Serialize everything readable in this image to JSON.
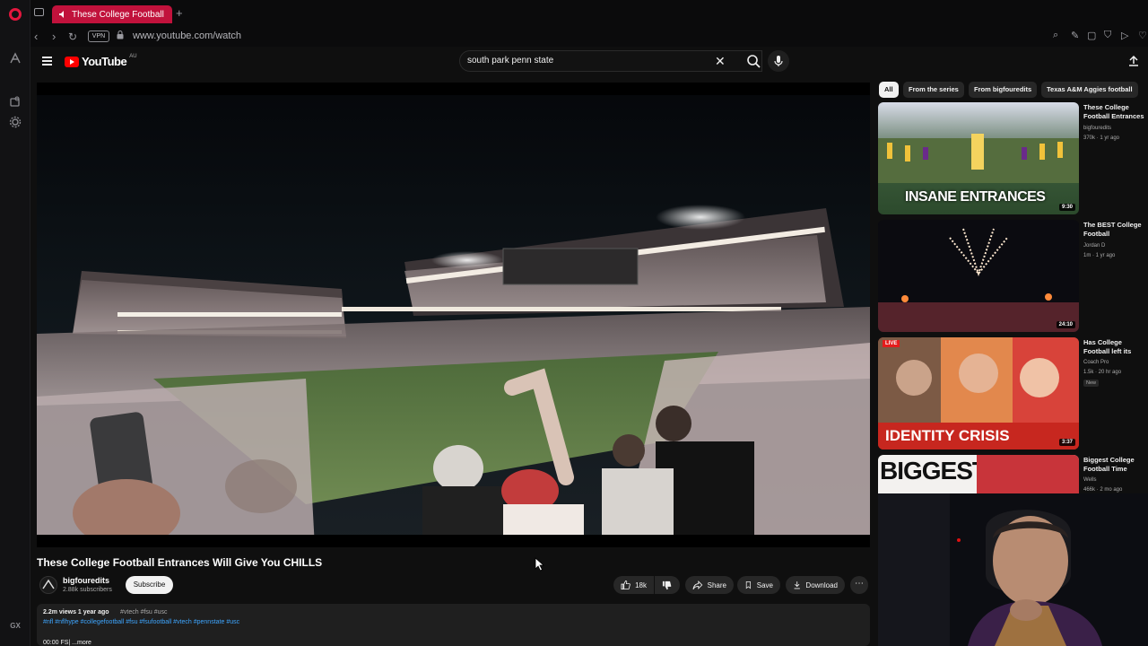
{
  "browser": {
    "tab_title": "These College Football",
    "url": "www.youtube.com/watch",
    "vpn_label": "VPN",
    "rail_bottom_label": "GX"
  },
  "youtube": {
    "region": "AU",
    "search_query": "south park penn state",
    "video": {
      "title": "These College Football Entrances Will Give You CHILLS",
      "channel": "bigfouredits",
      "subscribers": "2.88k subscribers",
      "subscribe_label": "Subscribe",
      "likes": "18k",
      "share_label": "Share",
      "save_label": "Save",
      "download_label": "Download",
      "views_age": "2.2m views  1 year ago",
      "top_tags": "#vtech #fsu #usc",
      "hashtags": "#nfl #nflhype #collegefootball #fsu #fsufootball #vtech #pennstate #usc",
      "desc_line": "00:00 FS|  ...more"
    },
    "chips": [
      "All",
      "From the series",
      "From bigfouredits",
      "Texas A&M Aggies football"
    ],
    "recommendations": [
      {
        "title": "These College Football Entrances Will Give You CHILLS",
        "channel": "bigfouredits",
        "meta": "370k · 1 yr ago",
        "duration": "9:30",
        "thumb_text": "INSANE ENTRANCES"
      },
      {
        "title": "The BEST College Football Crowds/Atmospheres",
        "channel": "Jordan D",
        "meta": "1m · 1 yr ago",
        "duration": "24:10"
      },
      {
        "title": "Has College Football left its teams behind?",
        "channel": "Coach Pro",
        "meta": "1.5k · 20 hr ago",
        "duration": "3:37",
        "badge": "New",
        "live_label": "LIVE",
        "thumb_text": "IDENTITY CRISIS"
      },
      {
        "title": "Biggest College Football Time",
        "channel": "Wells",
        "meta": "466k · 2 mo ago",
        "thumb_text": "BIGGEST"
      }
    ]
  },
  "colors": {
    "opera_red": "#c1123c",
    "yt_red": "#ff0000",
    "background": "#0f0f0f",
    "link_blue": "#3ea6ff"
  }
}
